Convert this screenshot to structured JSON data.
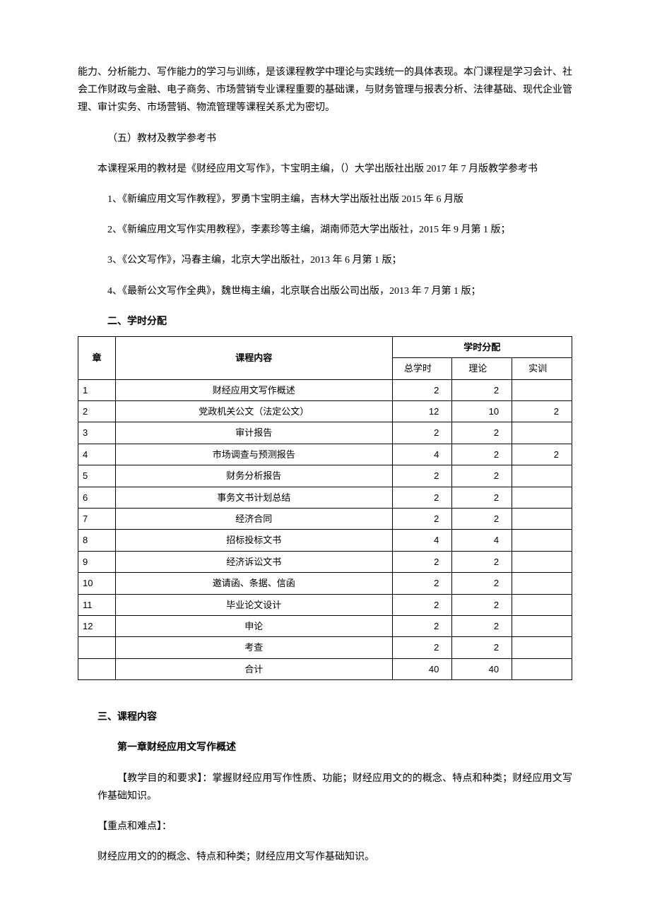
{
  "intro_paragraph": "能力、分析能力、写作能力的学习与训练，是该课程教学中理论与实践统一的具体表现。本门课程是学习会计、社会工作财政与金融、电子商务、市场营销专业课程重要的基础课，与财务管理与报表分析、法律基础、现代企业管理、审计实务、市场营销、物流管理等课程关系尤为密切。",
  "section5_title": "（五）教材及教学参考书",
  "textbook_main": "本课程采用的教材是《财经应用文写作》，卞宝明主编，（）大学出版社出版 2017 年 7 月版教学参考书",
  "refs": {
    "r1": "1、《新编应用文写作教程》，罗勇卞宝明主编，吉林大学出版社出版 2015 年 6 月版",
    "r2": "2、《新编应用文写作实用教程》，李素珍等主编，湖南师范大学出版社，2015 年 9 月第 1 版；",
    "r3": "3、《公文写作》，冯春主编，北京大学出版社，2013 年 6 月第 1 版；",
    "r4": "4、《最新公文写作全典》，魏世梅主编，北京联合出版公司出版，2013 年 7 月第 1 版；"
  },
  "section2_title": "二、学时分配",
  "chart_data": {
    "type": "table",
    "headers": {
      "chapter": "章",
      "content": "课程内容",
      "alloc_group": "学时分配",
      "total": "总学时",
      "theory": "理论",
      "practice": "实训"
    },
    "rows": [
      {
        "ch": "1",
        "content": "财经应用文写作概述",
        "total": "2",
        "theory": "2",
        "practice": ""
      },
      {
        "ch": "2",
        "content": "党政机关公文（法定公文）",
        "total": "12",
        "theory": "10",
        "practice": "2"
      },
      {
        "ch": "3",
        "content": "审计报告",
        "total": "2",
        "theory": "2",
        "practice": ""
      },
      {
        "ch": "4",
        "content": "市场调查与预测报告",
        "total": "4",
        "theory": "2",
        "practice": "2"
      },
      {
        "ch": "5",
        "content": "财务分析报告",
        "total": "2",
        "theory": "2",
        "practice": ""
      },
      {
        "ch": "6",
        "content": "事务文书计划总结",
        "total": "2",
        "theory": "2",
        "practice": ""
      },
      {
        "ch": "7",
        "content": "经济合同",
        "total": "2",
        "theory": "2",
        "practice": ""
      },
      {
        "ch": "8",
        "content": "招标投标文书",
        "total": "4",
        "theory": "4",
        "practice": ""
      },
      {
        "ch": "9",
        "content": "经济诉讼文书",
        "total": "2",
        "theory": "2",
        "practice": ""
      },
      {
        "ch": "10",
        "content": "邀请函、条据、信函",
        "total": "2",
        "theory": "2",
        "practice": ""
      },
      {
        "ch": "11",
        "content": "毕业论文设计",
        "total": "2",
        "theory": "2",
        "practice": ""
      },
      {
        "ch": "12",
        "content": "申论",
        "total": "2",
        "theory": "2",
        "practice": ""
      },
      {
        "ch": "",
        "content": "考查",
        "total": "2",
        "theory": "2",
        "practice": ""
      },
      {
        "ch": "",
        "content": "合计",
        "total": "40",
        "theory": "40",
        "practice": ""
      }
    ]
  },
  "section3_title": "三、课程内容",
  "chapter1_title": "第一章财经应用文写作概述",
  "chapter1_goal": "【教学目的和要求】：掌握财经应用写作性质、功能；财经应用文的的概念、特点和种类；财经应用文写作基础知识。",
  "chapter1_key_label": "【重点和难点】：",
  "chapter1_key_content": "财经应用文的的概念、特点和种类；财经应用文写作基础知识。"
}
